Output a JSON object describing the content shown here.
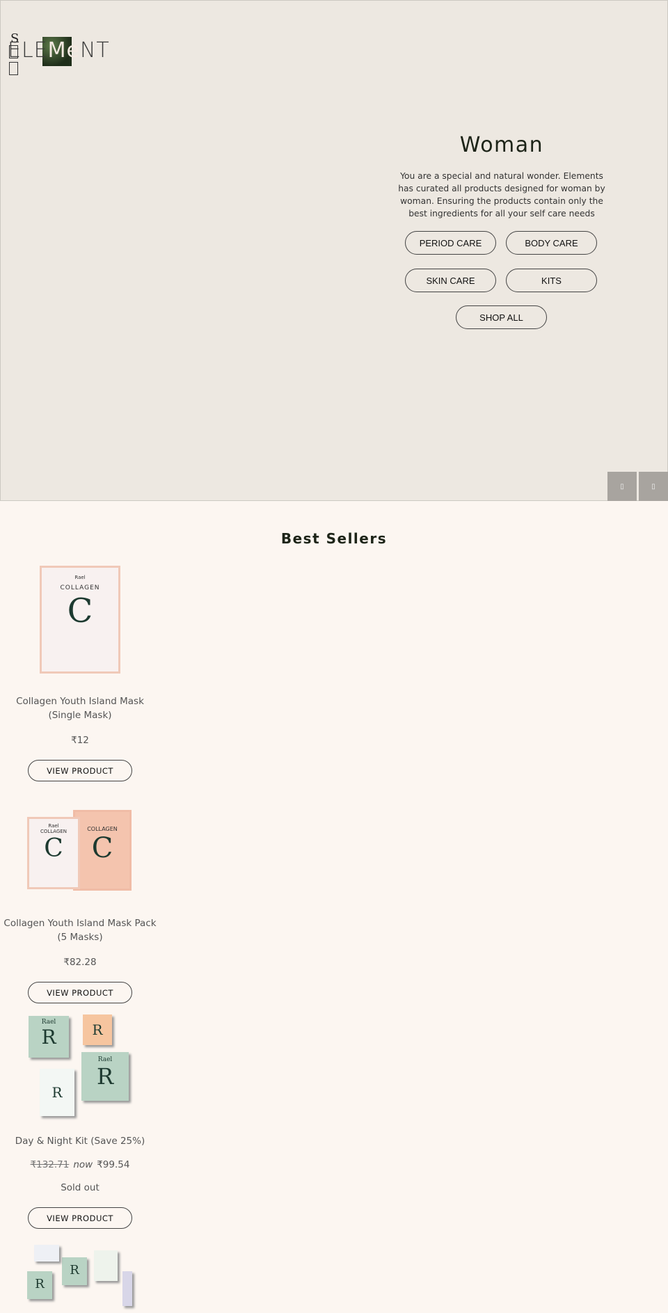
{
  "header": {
    "search_glyph": "S",
    "logo_text_a": "ELE",
    "logo_text_b": "Me",
    "logo_text_c": "NT"
  },
  "hero": {
    "title": "Woman",
    "description": "You are a special and natural wonder. Elements has curated all products designed for woman by woman. Ensuring the products contain only the best ingredients for all your self care needs",
    "buttons": [
      "PERIOD CARE",
      "BODY CARE",
      "SKIN CARE",
      "KITS",
      "SHOP ALL"
    ],
    "prev_icon": "chevron-left-icon",
    "next_icon": "chevron-right-icon"
  },
  "best_sellers": {
    "heading": "Best Sellers",
    "view_label": "VIEW PRODUCT",
    "products": [
      {
        "title": "Collagen Youth Island Mask (Single Mask)",
        "price": "₹12"
      },
      {
        "title": "Collagen Youth Island Mask Pack (5 Masks)",
        "price": "₹82.28"
      },
      {
        "title": "Day & Night Kit (Save 25%)",
        "old_price": "₹132.71",
        "now": "now",
        "price": "₹99.54",
        "status": "Sold out"
      }
    ],
    "image_text": {
      "brand": "Rael",
      "collagen": "COLLAGEN",
      "letter_c": "C",
      "letter_r": "R"
    }
  }
}
